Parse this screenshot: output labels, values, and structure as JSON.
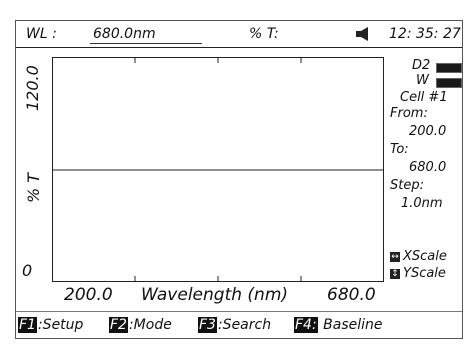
{
  "status": {
    "wl_label": "WL :",
    "wl_value": "680.0nm",
    "pt_label": "% T:",
    "time": "12: 35: 27"
  },
  "plot": {
    "y_top": "120.0",
    "y_mid": "% T",
    "y_bottom": "0",
    "x_min": "200.0",
    "x_label": "Wavelength (nm)",
    "x_max": "680.0"
  },
  "panel": {
    "lamp_d2": "D2",
    "lamp_w": "W",
    "cell": "Cell   #1",
    "from_label": "From:",
    "from_value": "200.0",
    "to_label": "To:",
    "to_value": "680.0",
    "step_label": "Step:",
    "step_value": "1.0nm",
    "xscale": "XScale",
    "yscale": "YScale"
  },
  "fkeys": [
    {
      "key": "F1",
      "label": ":Setup"
    },
    {
      "key": "F2",
      "label": ":Mode"
    },
    {
      "key": "F3",
      "label": ":Search"
    },
    {
      "key": "F4:",
      "label": " Baseline"
    }
  ],
  "icons": {
    "speaker": "speaker-icon",
    "xscale": "xscale-arrows-icon",
    "yscale": "yscale-arrows-icon"
  },
  "colors": {
    "screen_bg": "#ffffff",
    "text": "#111111",
    "key_bg": "#111111"
  }
}
